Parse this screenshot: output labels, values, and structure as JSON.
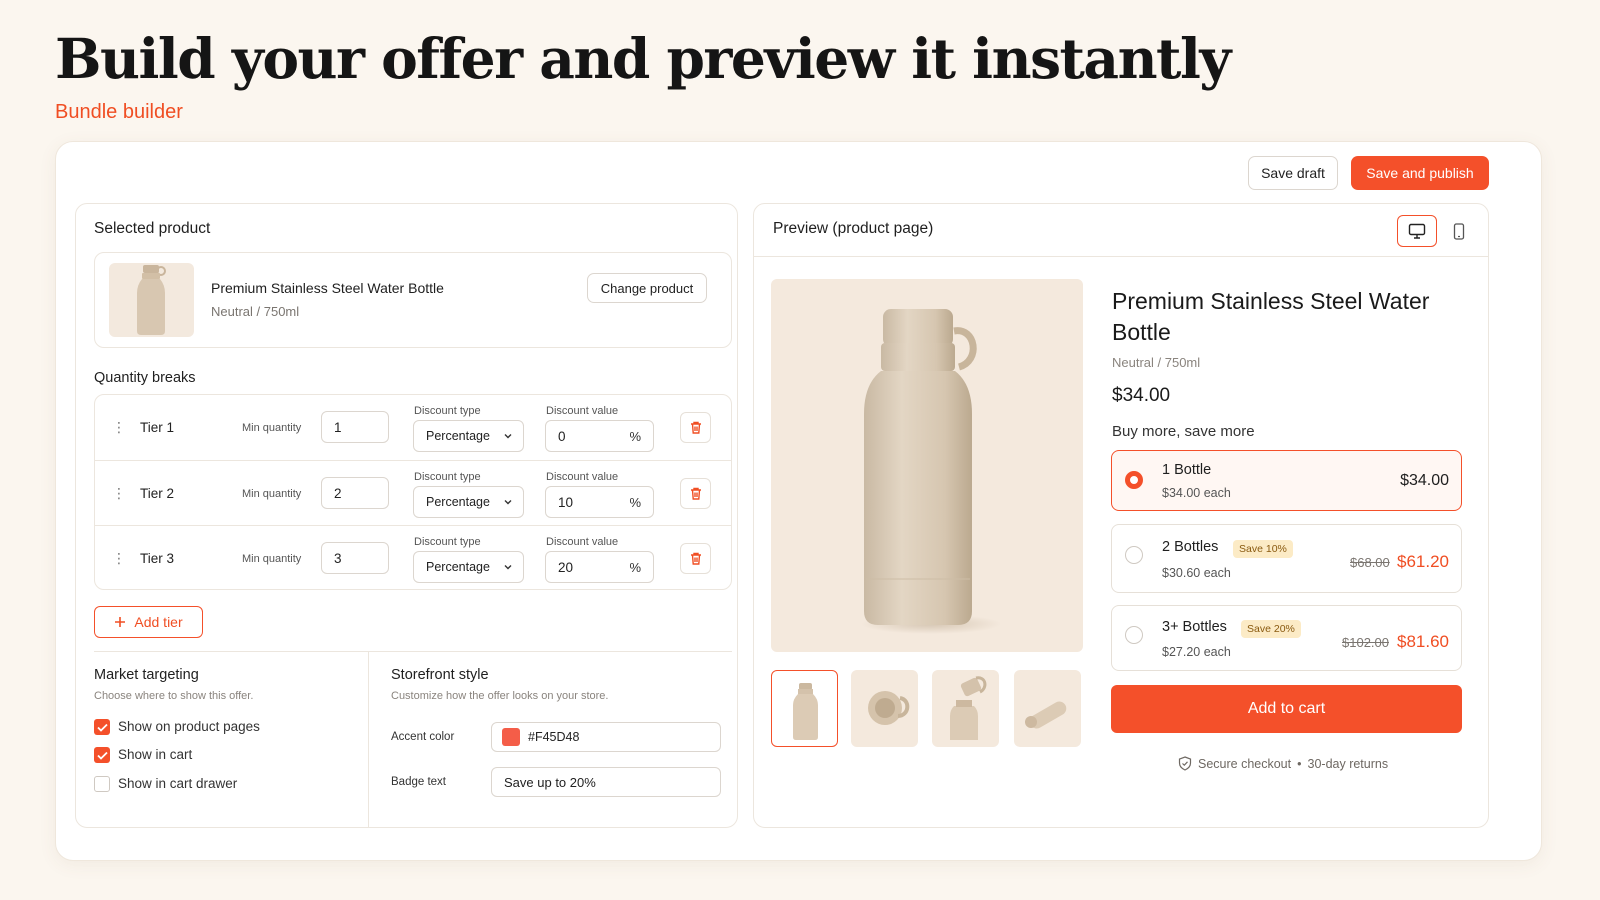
{
  "page": {
    "headline": "Build your offer and preview it instantly",
    "eyebrow": "Bundle builder"
  },
  "toolbar": {
    "save_draft": "Save draft",
    "save_publish": "Save and publish"
  },
  "editor": {
    "selected_product_title": "Selected product",
    "product": {
      "name": "Premium Stainless Steel Water Bottle",
      "variant": "Neutral / 750ml",
      "change_label": "Change product"
    },
    "quantity_breaks_title": "Quantity breaks",
    "tiers": [
      {
        "label": "Tier 1",
        "min_label": "Min quantity",
        "min": "1",
        "type_label": "Discount type",
        "type": "Percentage",
        "value_label": "Discount value",
        "value": "0",
        "unit": "%"
      },
      {
        "label": "Tier 2",
        "min_label": "Min quantity",
        "min": "2",
        "type_label": "Discount type",
        "type": "Percentage",
        "value_label": "Discount value",
        "value": "10",
        "unit": "%"
      },
      {
        "label": "Tier 3",
        "min_label": "Min quantity",
        "min": "3",
        "type_label": "Discount type",
        "type": "Percentage",
        "value_label": "Discount value",
        "value": "20",
        "unit": "%"
      }
    ],
    "add_tier": "Add tier",
    "market": {
      "title": "Market targeting",
      "desc": "Choose where to show this offer.",
      "options": [
        {
          "label": "Show on product pages",
          "checked": true
        },
        {
          "label": "Show in cart",
          "checked": true
        },
        {
          "label": "Show in cart drawer",
          "checked": false
        }
      ]
    },
    "storefront": {
      "title": "Storefront style",
      "desc": "Customize how the offer looks on your store.",
      "accent_label": "Accent color",
      "accent_value": "#F45D48",
      "badge_label": "Badge text",
      "badge_value": "Save up to 20%"
    }
  },
  "preview": {
    "title": "Preview (product page)",
    "devices": [
      "desktop-icon",
      "mobile-icon"
    ],
    "product_title": "Premium Stainless Steel Water Bottle",
    "variant": "Neutral / 750ml",
    "price": "$34.00",
    "buy_more": "Buy more, save more",
    "options": [
      {
        "name": "1 Bottle",
        "each": "$34.00 each",
        "badge": "",
        "compare": "",
        "price": "$34.00",
        "selected": true
      },
      {
        "name": "2 Bottles",
        "each": "$30.60 each",
        "badge": "Save 10%",
        "compare": "$68.00",
        "price": "$61.20",
        "selected": false
      },
      {
        "name": "3+ Bottles",
        "each": "$27.20 each",
        "badge": "Save 20%",
        "compare": "$102.00",
        "price": "$81.60",
        "selected": false
      }
    ],
    "add_to_cart": "Add to cart",
    "secure_text": "Secure checkout",
    "returns_text": "30-day returns"
  },
  "colors": {
    "accent": "#F4502A",
    "background": "#FBF6EF",
    "badge_bg": "#FCEBC6",
    "swatch": "#F45D48"
  }
}
